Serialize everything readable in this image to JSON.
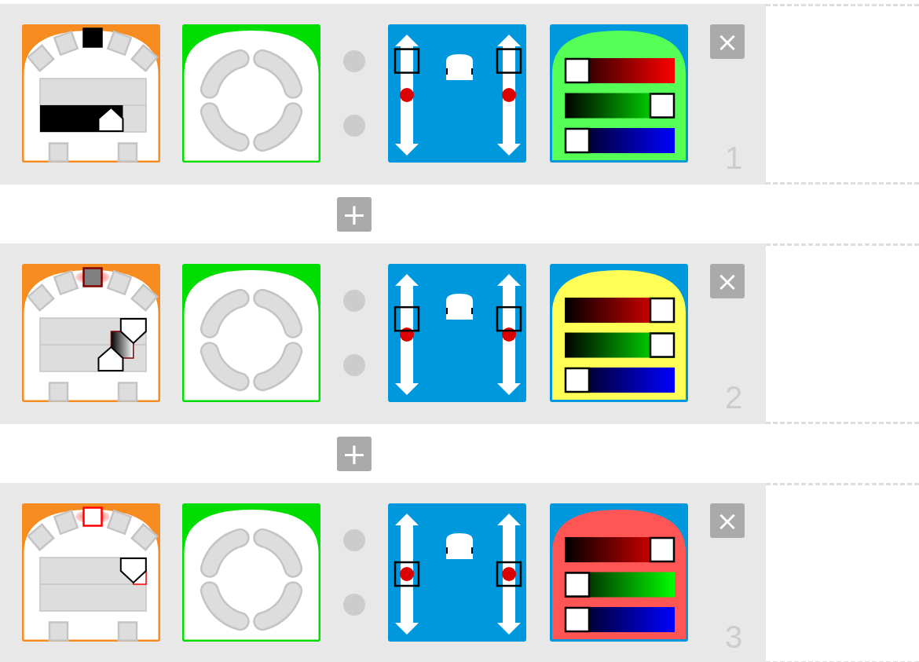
{
  "rows": [
    {
      "number": "1",
      "delete_label": "×",
      "event": {
        "front_sensors": [
          {
            "kind": "unused"
          },
          {
            "kind": "unused"
          },
          {
            "kind": "black"
          },
          {
            "kind": "unused"
          },
          {
            "kind": "unused"
          }
        ],
        "rear_sensors": [
          {
            "kind": "unused"
          },
          {
            "kind": "unused"
          }
        ],
        "thresholds": [
          {
            "kind": "lower",
            "level": 0.67
          }
        ]
      },
      "motors": [
        {
          "level": 0.85
        },
        {
          "level": 0.85
        }
      ],
      "color_channels": [
        {
          "kind": "red",
          "level": 0
        },
        {
          "kind": "green",
          "level": 1
        },
        {
          "kind": "blue",
          "level": 0
        }
      ]
    },
    {
      "number": "2",
      "delete_label": "×",
      "event": {
        "front_sensors": [
          {
            "kind": "unused"
          },
          {
            "kind": "unused"
          },
          {
            "kind": "gray"
          },
          {
            "kind": "unused"
          },
          {
            "kind": "unused"
          }
        ],
        "rear_sensors": [
          {
            "kind": "unused"
          },
          {
            "kind": "unused"
          }
        ],
        "thresholds": [
          {
            "kind": "lower",
            "level": 0.67
          },
          {
            "kind": "upper",
            "level": 0.88
          }
        ]
      },
      "motors": [
        {
          "level": 0.66
        },
        {
          "level": 0.66
        }
      ],
      "color_channels": [
        {
          "kind": "red",
          "level": 1
        },
        {
          "kind": "green",
          "level": 1
        },
        {
          "kind": "blue",
          "level": 0
        }
      ]
    },
    {
      "number": "3",
      "delete_label": "×",
      "event": {
        "front_sensors": [
          {
            "kind": "unused"
          },
          {
            "kind": "unused"
          },
          {
            "kind": "white"
          },
          {
            "kind": "unused"
          },
          {
            "kind": "unused"
          }
        ],
        "rear_sensors": [
          {
            "kind": "unused"
          },
          {
            "kind": "unused"
          }
        ],
        "thresholds": [
          {
            "kind": "upper",
            "level": 0.88
          }
        ]
      },
      "motors": [
        {
          "level": 0.5
        },
        {
          "level": 0.5
        }
      ],
      "color_channels": [
        {
          "kind": "red",
          "level": 1
        },
        {
          "kind": "green",
          "level": 0
        },
        {
          "kind": "blue",
          "level": 0
        }
      ]
    }
  ],
  "add_buttons": [
    "+",
    "+"
  ]
}
